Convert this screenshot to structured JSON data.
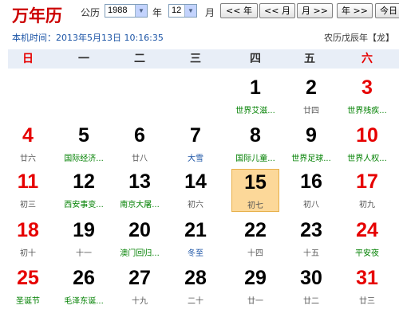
{
  "app": {
    "title": "万年历"
  },
  "toolbar": {
    "gregorian_label": "公历",
    "year_value": "1988",
    "year_label": "年",
    "month_value": "12",
    "month_label": "月",
    "prev_year_btn": "<< 年",
    "prev_month_btn": "<< 月",
    "next_month_btn": "月 >>",
    "next_year_btn": "年 >>",
    "today_btn": "今日"
  },
  "status": {
    "local_time": "本机时间：2013年5月13日 10:16:35",
    "lunar_year": "农历戊辰年【龙】"
  },
  "weekdays": [
    "日",
    "一",
    "二",
    "三",
    "四",
    "五",
    "六"
  ],
  "weeks": [
    [
      null,
      null,
      null,
      null,
      {
        "day": "1",
        "sub": "世界艾滋...",
        "type": "holiday"
      },
      {
        "day": "2",
        "sub": "廿四",
        "type": "lunar"
      },
      {
        "day": "3",
        "sub": "世界残疾...",
        "type": "holiday"
      }
    ],
    [
      {
        "day": "4",
        "sub": "廿六",
        "type": "lunar"
      },
      {
        "day": "5",
        "sub": "国际经济...",
        "type": "holiday"
      },
      {
        "day": "6",
        "sub": "廿八",
        "type": "lunar"
      },
      {
        "day": "7",
        "sub": "大雪",
        "type": "term"
      },
      {
        "day": "8",
        "sub": "国际儿童...",
        "type": "holiday"
      },
      {
        "day": "9",
        "sub": "世界足球...",
        "type": "holiday"
      },
      {
        "day": "10",
        "sub": "世界人权...",
        "type": "holiday"
      }
    ],
    [
      {
        "day": "11",
        "sub": "初三",
        "type": "lunar"
      },
      {
        "day": "12",
        "sub": "西安事变...",
        "type": "holiday"
      },
      {
        "day": "13",
        "sub": "南京大屠...",
        "type": "holiday"
      },
      {
        "day": "14",
        "sub": "初六",
        "type": "lunar"
      },
      {
        "day": "15",
        "sub": "初七",
        "type": "lunar",
        "today": true
      },
      {
        "day": "16",
        "sub": "初八",
        "type": "lunar"
      },
      {
        "day": "17",
        "sub": "初九",
        "type": "lunar"
      }
    ],
    [
      {
        "day": "18",
        "sub": "初十",
        "type": "lunar"
      },
      {
        "day": "19",
        "sub": "十一",
        "type": "lunar"
      },
      {
        "day": "20",
        "sub": "澳门回归...",
        "type": "holiday"
      },
      {
        "day": "21",
        "sub": "冬至",
        "type": "term"
      },
      {
        "day": "22",
        "sub": "十四",
        "type": "lunar"
      },
      {
        "day": "23",
        "sub": "十五",
        "type": "lunar"
      },
      {
        "day": "24",
        "sub": "平安夜",
        "type": "holiday"
      }
    ],
    [
      {
        "day": "25",
        "sub": "圣诞节",
        "type": "holiday"
      },
      {
        "day": "26",
        "sub": "毛泽东诞...",
        "type": "holiday"
      },
      {
        "day": "27",
        "sub": "十九",
        "type": "lunar"
      },
      {
        "day": "28",
        "sub": "二十",
        "type": "lunar"
      },
      {
        "day": "29",
        "sub": "廿一",
        "type": "lunar"
      },
      {
        "day": "30",
        "sub": "廿二",
        "type": "lunar"
      },
      {
        "day": "31",
        "sub": "廿三",
        "type": "lunar"
      }
    ]
  ],
  "colors": {
    "weekend": "#e60000",
    "holiday": "#008000",
    "term": "#1a53a5",
    "today_bg": "#fcd899"
  }
}
